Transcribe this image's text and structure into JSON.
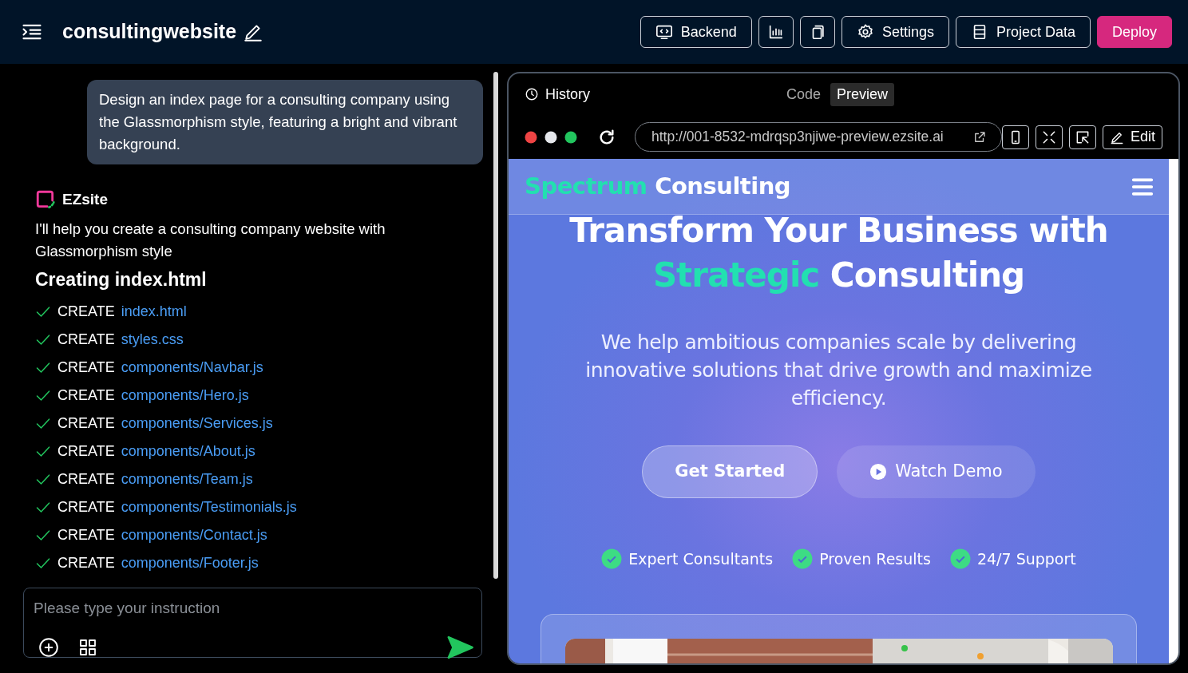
{
  "header": {
    "title": "consultingwebsite",
    "buttons": [
      {
        "kind": "text",
        "label": "Backend"
      },
      {
        "kind": "icon"
      },
      {
        "kind": "icon"
      },
      {
        "kind": "text",
        "label": "Settings"
      },
      {
        "kind": "text",
        "label": "Project Data"
      },
      {
        "kind": "primary",
        "label": "Deploy"
      }
    ]
  },
  "chat": {
    "user_message": "Design an index page for a consulting company using the Glassmorphism style, featuring a bright and vibrant background.",
    "assistant": {
      "name": "EZsite",
      "message": "I'll help you create a consulting company website with Glassmorphism style",
      "heading": "Creating index.html",
      "files": [
        {
          "action": "CREATE",
          "path": "index.html"
        },
        {
          "action": "CREATE",
          "path": "styles.css"
        },
        {
          "action": "CREATE",
          "path": "components/Navbar.js"
        },
        {
          "action": "CREATE",
          "path": "components/Hero.js"
        },
        {
          "action": "CREATE",
          "path": "components/Services.js"
        },
        {
          "action": "CREATE",
          "path": "components/About.js"
        },
        {
          "action": "CREATE",
          "path": "components/Team.js"
        },
        {
          "action": "CREATE",
          "path": "components/Testimonials.js"
        },
        {
          "action": "CREATE",
          "path": "components/Contact.js"
        },
        {
          "action": "CREATE",
          "path": "components/Footer.js"
        }
      ]
    },
    "input": {
      "placeholder": "Please type your instruction"
    }
  },
  "preview": {
    "history": "History",
    "view_tabs": [
      {
        "label": "Code",
        "selected": false
      },
      {
        "label": "Preview",
        "selected": true
      }
    ],
    "url": "http://001-8532-mdrqsp3njiwe-preview.ezsite.ai",
    "edit": "Edit",
    "site": {
      "brand": [
        {
          "text": "Spectrum",
          "accent": true
        },
        {
          "text": "Consulting",
          "accent": false
        }
      ],
      "title_lines": [
        [
          {
            "text": "Transform Your Business with",
            "accent": false
          }
        ],
        [
          {
            "text": "Strategic",
            "accent": true
          },
          {
            "text": "Consulting",
            "accent": false
          }
        ]
      ],
      "subtitle": "We help ambitious companies scale by delivering innovative solutions that drive growth and maximize efficiency.",
      "buttons": [
        {
          "kind": "primary",
          "label": "Get Started"
        },
        {
          "kind": "play",
          "label": "Watch Demo"
        }
      ],
      "features": [
        "Expert Consultants",
        "Proven Results",
        "24/7 Support"
      ],
      "showcase": {
        "kind": "picture"
      }
    }
  }
}
